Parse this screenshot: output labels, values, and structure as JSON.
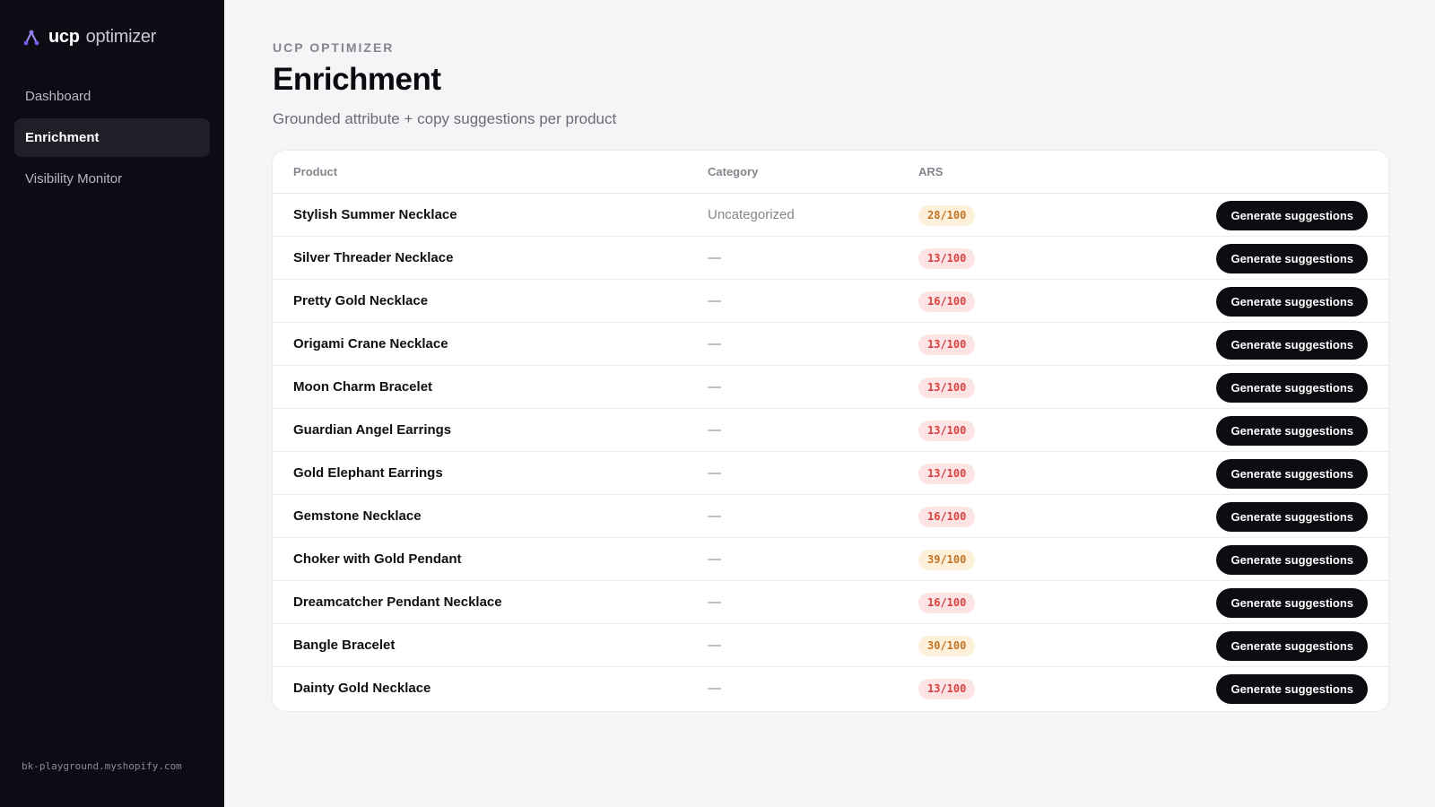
{
  "brand": {
    "name_strong": "ucp",
    "name_light": "optimizer",
    "icon": "triangle-nodes-icon"
  },
  "nav": [
    {
      "label": "Dashboard",
      "active": false
    },
    {
      "label": "Enrichment",
      "active": true
    },
    {
      "label": "Visibility Monitor",
      "active": false
    }
  ],
  "store_domain": "bk-playground.myshopify.com",
  "header": {
    "eyebrow": "UCP OPTIMIZER",
    "title": "Enrichment",
    "subtitle": "Grounded attribute + copy suggestions per product"
  },
  "table": {
    "columns": {
      "product": "Product",
      "category": "Category",
      "ars": "ARS",
      "action": ""
    },
    "button_label": "Generate suggestions",
    "colors": {
      "low_bg": "#fde4e4",
      "low_fg": "#d94040",
      "mid_bg": "#fdf0db",
      "mid_fg": "#c27324"
    },
    "rows": [
      {
        "product": "Stylish Summer Necklace",
        "category": "Uncategorized",
        "ars": "28/100",
        "level": "mid"
      },
      {
        "product": "Silver Threader Necklace",
        "category": "—",
        "ars": "13/100",
        "level": "low"
      },
      {
        "product": "Pretty Gold Necklace",
        "category": "—",
        "ars": "16/100",
        "level": "low"
      },
      {
        "product": "Origami Crane Necklace",
        "category": "—",
        "ars": "13/100",
        "level": "low"
      },
      {
        "product": "Moon Charm Bracelet",
        "category": "—",
        "ars": "13/100",
        "level": "low"
      },
      {
        "product": "Guardian Angel Earrings",
        "category": "—",
        "ars": "13/100",
        "level": "low"
      },
      {
        "product": "Gold Elephant Earrings",
        "category": "—",
        "ars": "13/100",
        "level": "low"
      },
      {
        "product": "Gemstone Necklace",
        "category": "—",
        "ars": "16/100",
        "level": "low"
      },
      {
        "product": "Choker with Gold Pendant",
        "category": "—",
        "ars": "39/100",
        "level": "mid"
      },
      {
        "product": "Dreamcatcher Pendant Necklace",
        "category": "—",
        "ars": "16/100",
        "level": "low"
      },
      {
        "product": "Bangle Bracelet",
        "category": "—",
        "ars": "30/100",
        "level": "mid"
      },
      {
        "product": "Dainty Gold Necklace",
        "category": "—",
        "ars": "13/100",
        "level": "low"
      }
    ]
  }
}
